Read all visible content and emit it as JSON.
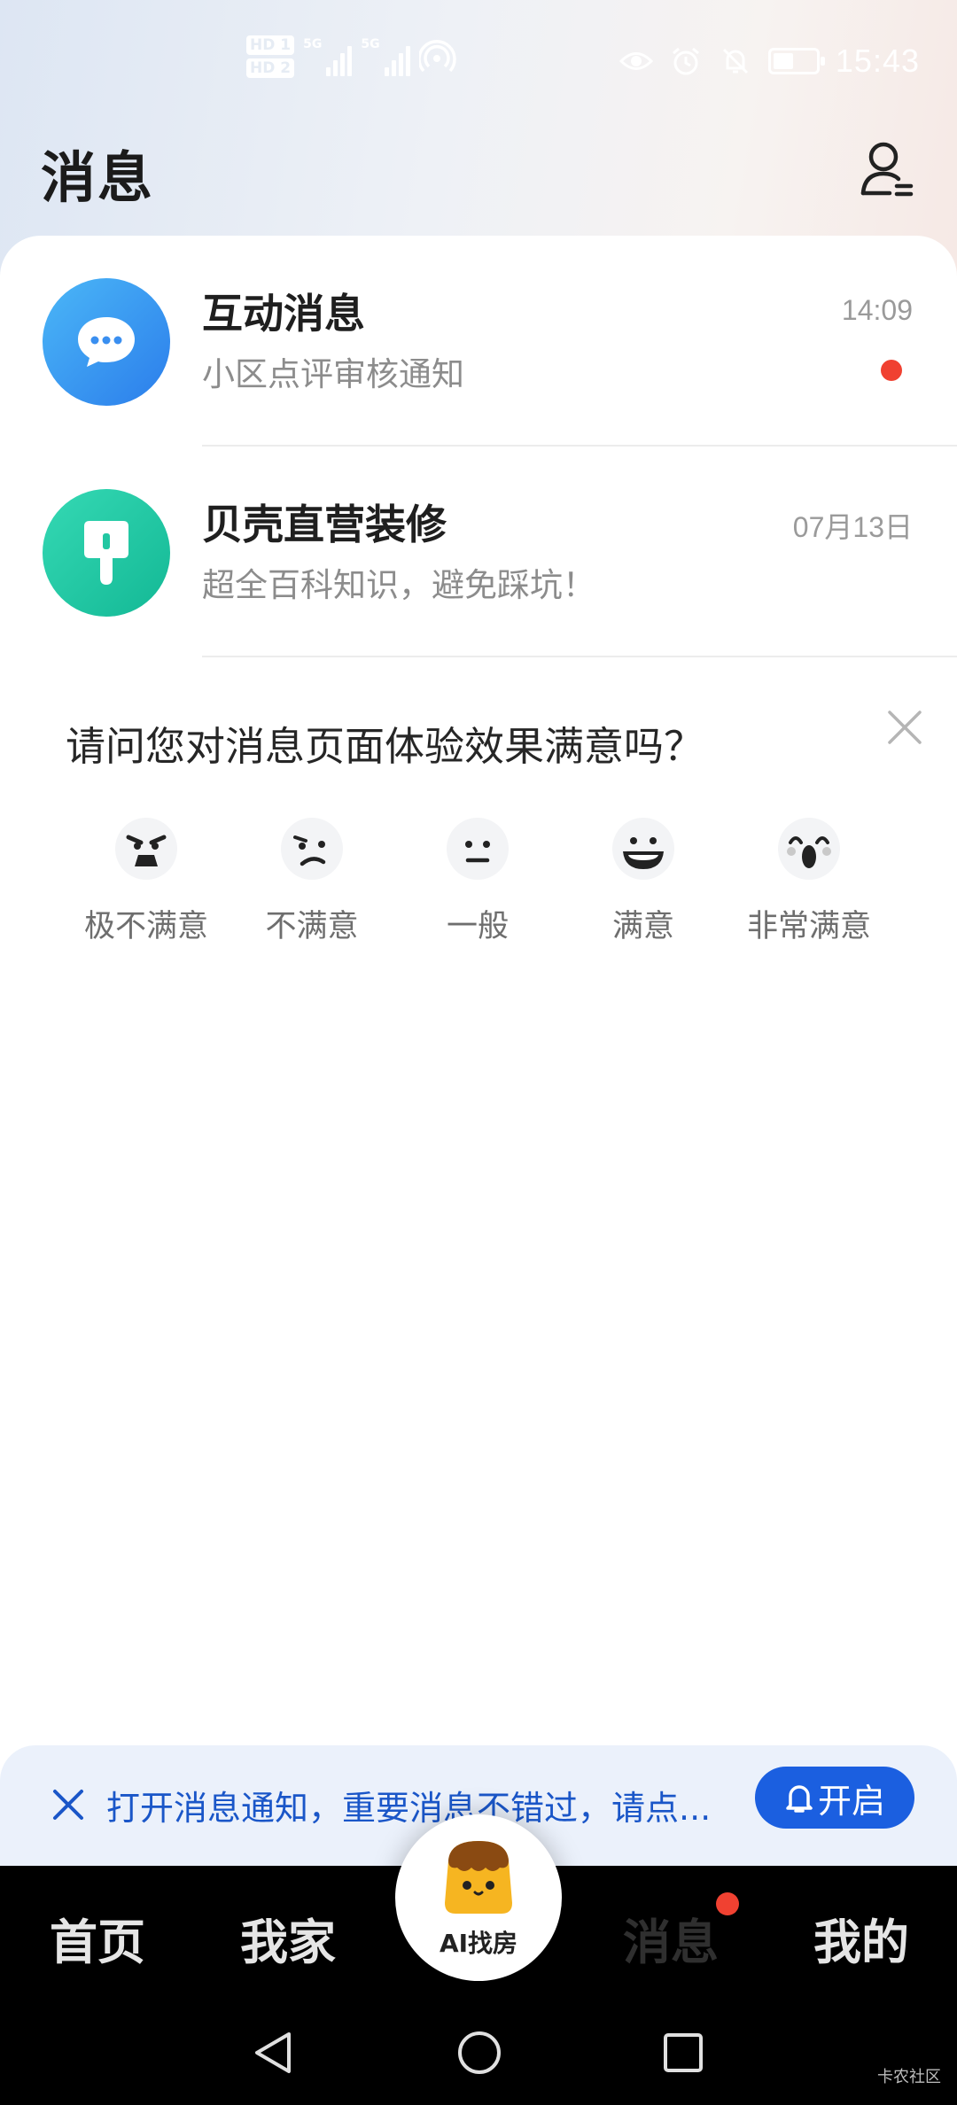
{
  "status_bar": {
    "hd1": "HD 1",
    "hd2": "HD 2",
    "net1": "5G",
    "net2": "5G",
    "time": "15:43"
  },
  "header": {
    "title": "消息",
    "contact_icon": "contact-person-icon"
  },
  "messages": [
    {
      "title": "互动消息",
      "subtitle": "小区点评审核通知",
      "time": "14:09",
      "unread": true,
      "icon": "chat-bubble-icon",
      "color": "#3a8ff0"
    },
    {
      "title": "贝壳直营装修",
      "subtitle": "超全百科知识，避免踩坑！",
      "time": "07月13日",
      "unread": false,
      "icon": "paint-brush-icon",
      "color": "#22c7a2"
    }
  ],
  "survey": {
    "question": "请问您对消息页面体验效果满意吗？",
    "options": [
      {
        "label": "极不满意",
        "icon": "angry-face-icon"
      },
      {
        "label": "不满意",
        "icon": "unhappy-face-icon"
      },
      {
        "label": "一般",
        "icon": "neutral-face-icon"
      },
      {
        "label": "满意",
        "icon": "smile-face-icon"
      },
      {
        "label": "非常满意",
        "icon": "excited-face-icon"
      }
    ]
  },
  "notify": {
    "text": "打开消息通知，重要消息不错过，请点...",
    "button_label": "开启",
    "accent": "#1b5fe0"
  },
  "tab_bar": {
    "tabs": [
      {
        "label": "首页",
        "active": false
      },
      {
        "label": "我家",
        "active": false
      },
      {
        "label": "AI找房",
        "active": false
      },
      {
        "label": "消息",
        "active": true,
        "badge": true
      },
      {
        "label": "我的",
        "active": false
      }
    ]
  },
  "watermark": "卡农社区"
}
